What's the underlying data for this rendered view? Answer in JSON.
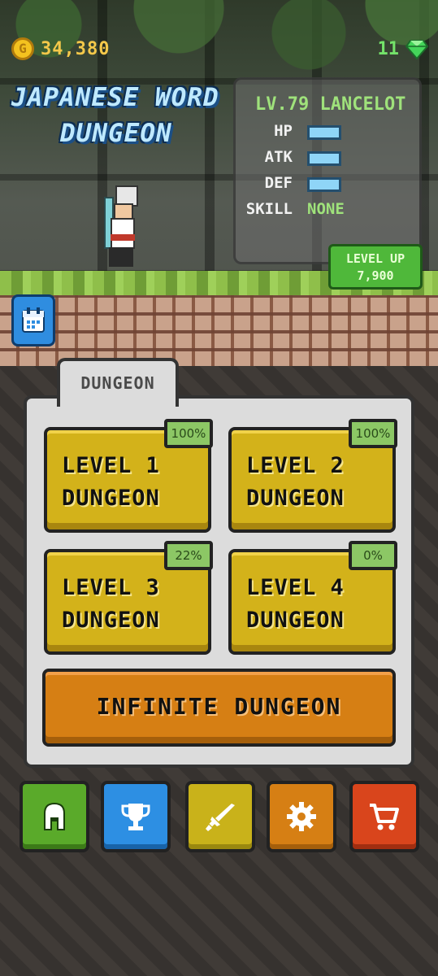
{
  "hud": {
    "coin_symbol": "G",
    "coins": "34,380",
    "gems": "11",
    "coin_icon": "gold-coin-icon",
    "gem_icon": "green-gem-icon"
  },
  "title": {
    "line1": "JAPANESE WORD",
    "line2": "DUNGEON"
  },
  "character": {
    "header": "LV.79 LANCELOT",
    "level": 79,
    "name": "LANCELOT",
    "stats": [
      {
        "label": "HP",
        "fill": 1.0
      },
      {
        "label": "ATK",
        "fill": 1.0
      },
      {
        "label": "DEF",
        "fill": 1.0
      }
    ],
    "skill_label": "SKILL",
    "skill_value": "NONE"
  },
  "level_up": {
    "label": "LEVEL UP",
    "cost": "7,900"
  },
  "calendar": {
    "icon": "calendar-icon"
  },
  "dungeon": {
    "tab_label": "DUNGEON",
    "levels": [
      {
        "label": "LEVEL 1\nDUNGEON",
        "progress": "100%"
      },
      {
        "label": "LEVEL 2\nDUNGEON",
        "progress": "100%"
      },
      {
        "label": "LEVEL 3\nDUNGEON",
        "progress": "22%"
      },
      {
        "label": "LEVEL 4\nDUNGEON",
        "progress": "0%"
      }
    ],
    "infinite_label": "INFINITE DUNGEON"
  },
  "nav": [
    {
      "icon": "helmet-icon",
      "color": "#5aaa2a"
    },
    {
      "icon": "trophy-icon",
      "color": "#2d8fe3"
    },
    {
      "icon": "sword-icon",
      "color": "#c9b21a"
    },
    {
      "icon": "gear-icon",
      "color": "#d67f14"
    },
    {
      "icon": "cart-icon",
      "color": "#d9451c"
    }
  ],
  "colors": {
    "coin": "#f4c84a",
    "gem": "#74e36a",
    "title": "#bfe9ff",
    "stat_green": "#9fe27b",
    "level_button": "#d3b21a",
    "infinite_button": "#d67f14",
    "level_up_button": "#4fb83a"
  }
}
